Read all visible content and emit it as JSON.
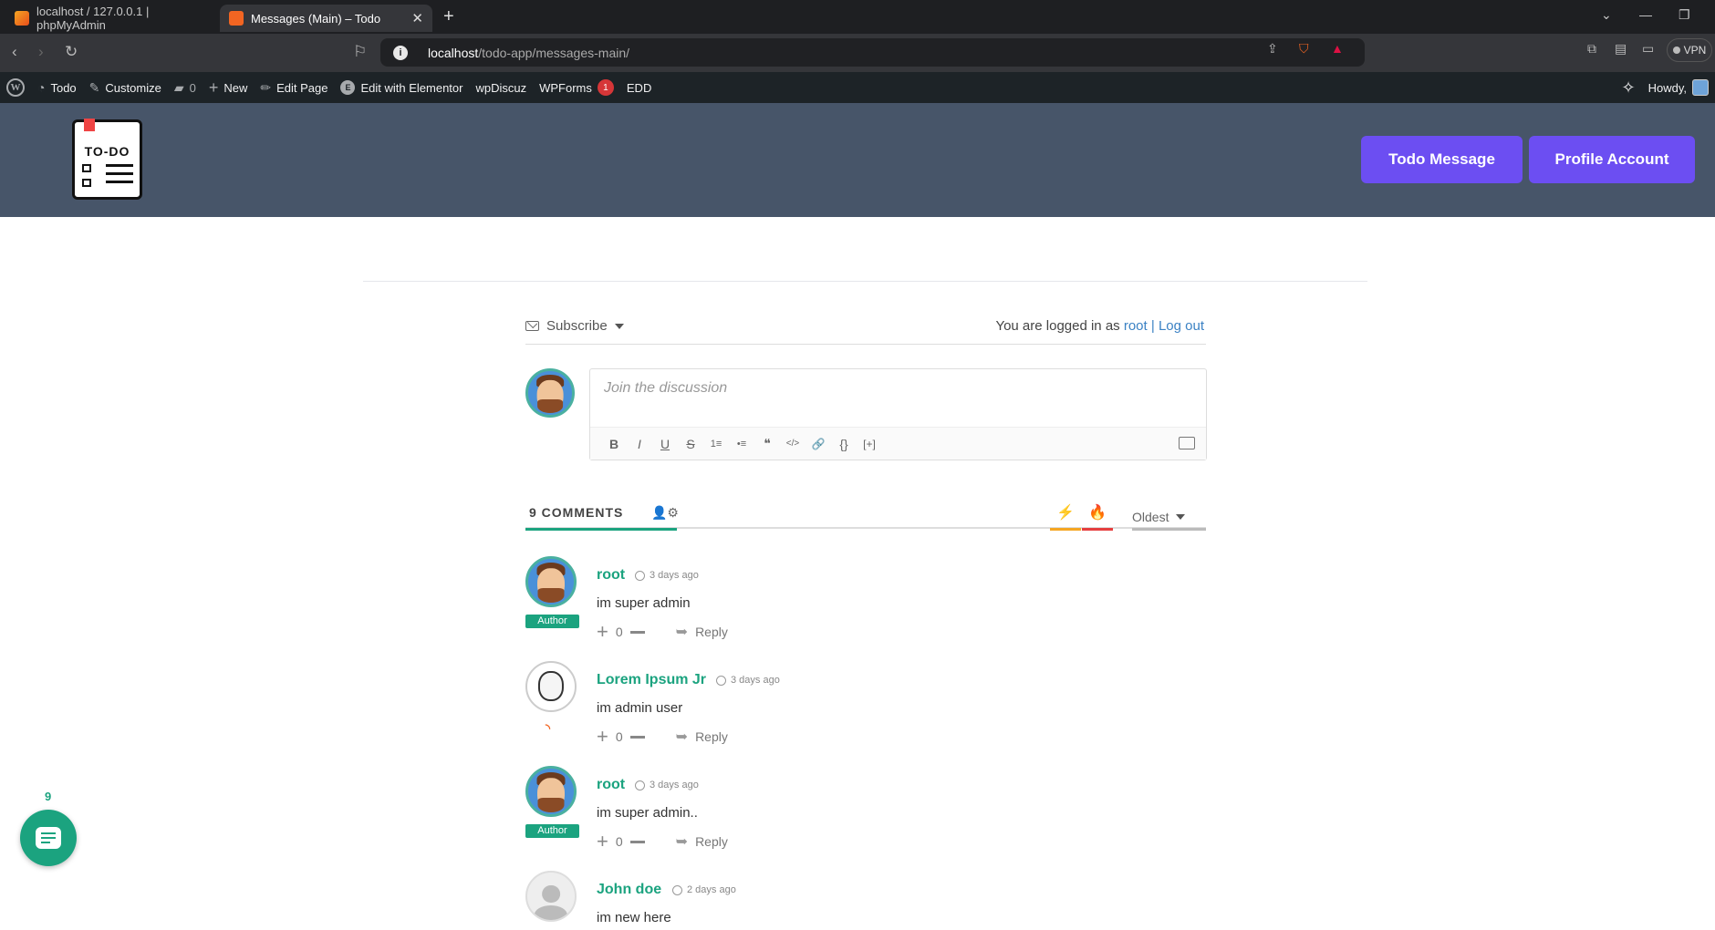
{
  "browser": {
    "tabs": [
      {
        "title": "localhost / 127.0.0.1 | phpMyAdmin",
        "active": false
      },
      {
        "title": "Messages (Main) – Todo",
        "active": true
      }
    ],
    "url_host": "localhost",
    "url_path": "/todo-app/messages-main/",
    "vpn_label": "VPN"
  },
  "adminbar": {
    "site": "Todo",
    "customize": "Customize",
    "comments_count": "0",
    "new": "New",
    "edit_page": "Edit Page",
    "elementor": "Edit with Elementor",
    "wpdiscuz": "wpDiscuz",
    "wpforms": "WPForms",
    "wpforms_badge": "1",
    "edd": "EDD",
    "howdy": "Howdy,"
  },
  "header": {
    "logo_text": "TO-DO",
    "buttons": [
      "Todo Message",
      "Profile Account"
    ],
    "accent": "#6c4ef2",
    "bg": "#475569"
  },
  "discussion": {
    "subscribe": "Subscribe",
    "logged_in_prefix": "You are logged in as",
    "user": "root",
    "separator": "|",
    "logout": "Log out",
    "placeholder": "Join the discussion",
    "toolbar": [
      "B",
      "I",
      "U",
      "S",
      "1≡",
      "•≡",
      "❝",
      "</>",
      "🔗",
      "{}",
      "[+]"
    ],
    "comments_title": "9 COMMENTS",
    "sort": "Oldest",
    "accent": "#1ba37f"
  },
  "comments": [
    {
      "author": "root",
      "time": "3 days ago",
      "text": "im super admin",
      "badge": "Author",
      "votes": "0",
      "reply": "Reply"
    },
    {
      "author": "Lorem Ipsum Jr",
      "time": "3 days ago",
      "text": "im admin user",
      "badge": "",
      "votes": "0",
      "reply": "Reply"
    },
    {
      "author": "root",
      "time": "3 days ago",
      "text": "im super admin..",
      "badge": "Author",
      "votes": "0",
      "reply": "Reply"
    },
    {
      "author": "John doe",
      "time": "2 days ago",
      "text": "im new here",
      "badge": "",
      "votes": "",
      "reply": ""
    }
  ],
  "bubble_count": "9"
}
